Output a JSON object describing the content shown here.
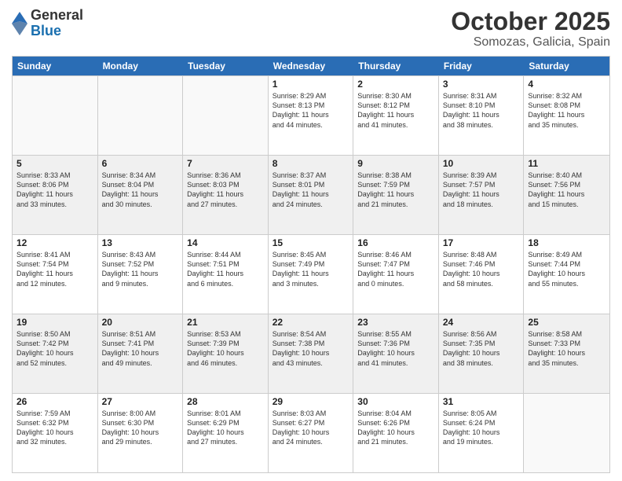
{
  "header": {
    "logo_general": "General",
    "logo_blue": "Blue",
    "title": "October 2025",
    "subtitle": "Somozas, Galicia, Spain"
  },
  "weekdays": [
    "Sunday",
    "Monday",
    "Tuesday",
    "Wednesday",
    "Thursday",
    "Friday",
    "Saturday"
  ],
  "rows": [
    [
      {
        "day": "",
        "empty": true
      },
      {
        "day": "",
        "empty": true
      },
      {
        "day": "",
        "empty": true
      },
      {
        "day": "1",
        "lines": [
          "Sunrise: 8:29 AM",
          "Sunset: 8:13 PM",
          "Daylight: 11 hours",
          "and 44 minutes."
        ]
      },
      {
        "day": "2",
        "lines": [
          "Sunrise: 8:30 AM",
          "Sunset: 8:12 PM",
          "Daylight: 11 hours",
          "and 41 minutes."
        ]
      },
      {
        "day": "3",
        "lines": [
          "Sunrise: 8:31 AM",
          "Sunset: 8:10 PM",
          "Daylight: 11 hours",
          "and 38 minutes."
        ]
      },
      {
        "day": "4",
        "lines": [
          "Sunrise: 8:32 AM",
          "Sunset: 8:08 PM",
          "Daylight: 11 hours",
          "and 35 minutes."
        ]
      }
    ],
    [
      {
        "day": "5",
        "lines": [
          "Sunrise: 8:33 AM",
          "Sunset: 8:06 PM",
          "Daylight: 11 hours",
          "and 33 minutes."
        ]
      },
      {
        "day": "6",
        "lines": [
          "Sunrise: 8:34 AM",
          "Sunset: 8:04 PM",
          "Daylight: 11 hours",
          "and 30 minutes."
        ]
      },
      {
        "day": "7",
        "lines": [
          "Sunrise: 8:36 AM",
          "Sunset: 8:03 PM",
          "Daylight: 11 hours",
          "and 27 minutes."
        ]
      },
      {
        "day": "8",
        "lines": [
          "Sunrise: 8:37 AM",
          "Sunset: 8:01 PM",
          "Daylight: 11 hours",
          "and 24 minutes."
        ]
      },
      {
        "day": "9",
        "lines": [
          "Sunrise: 8:38 AM",
          "Sunset: 7:59 PM",
          "Daylight: 11 hours",
          "and 21 minutes."
        ]
      },
      {
        "day": "10",
        "lines": [
          "Sunrise: 8:39 AM",
          "Sunset: 7:57 PM",
          "Daylight: 11 hours",
          "and 18 minutes."
        ]
      },
      {
        "day": "11",
        "lines": [
          "Sunrise: 8:40 AM",
          "Sunset: 7:56 PM",
          "Daylight: 11 hours",
          "and 15 minutes."
        ]
      }
    ],
    [
      {
        "day": "12",
        "lines": [
          "Sunrise: 8:41 AM",
          "Sunset: 7:54 PM",
          "Daylight: 11 hours",
          "and 12 minutes."
        ]
      },
      {
        "day": "13",
        "lines": [
          "Sunrise: 8:43 AM",
          "Sunset: 7:52 PM",
          "Daylight: 11 hours",
          "and 9 minutes."
        ]
      },
      {
        "day": "14",
        "lines": [
          "Sunrise: 8:44 AM",
          "Sunset: 7:51 PM",
          "Daylight: 11 hours",
          "and 6 minutes."
        ]
      },
      {
        "day": "15",
        "lines": [
          "Sunrise: 8:45 AM",
          "Sunset: 7:49 PM",
          "Daylight: 11 hours",
          "and 3 minutes."
        ]
      },
      {
        "day": "16",
        "lines": [
          "Sunrise: 8:46 AM",
          "Sunset: 7:47 PM",
          "Daylight: 11 hours",
          "and 0 minutes."
        ]
      },
      {
        "day": "17",
        "lines": [
          "Sunrise: 8:48 AM",
          "Sunset: 7:46 PM",
          "Daylight: 10 hours",
          "and 58 minutes."
        ]
      },
      {
        "day": "18",
        "lines": [
          "Sunrise: 8:49 AM",
          "Sunset: 7:44 PM",
          "Daylight: 10 hours",
          "and 55 minutes."
        ]
      }
    ],
    [
      {
        "day": "19",
        "lines": [
          "Sunrise: 8:50 AM",
          "Sunset: 7:42 PM",
          "Daylight: 10 hours",
          "and 52 minutes."
        ]
      },
      {
        "day": "20",
        "lines": [
          "Sunrise: 8:51 AM",
          "Sunset: 7:41 PM",
          "Daylight: 10 hours",
          "and 49 minutes."
        ]
      },
      {
        "day": "21",
        "lines": [
          "Sunrise: 8:53 AM",
          "Sunset: 7:39 PM",
          "Daylight: 10 hours",
          "and 46 minutes."
        ]
      },
      {
        "day": "22",
        "lines": [
          "Sunrise: 8:54 AM",
          "Sunset: 7:38 PM",
          "Daylight: 10 hours",
          "and 43 minutes."
        ]
      },
      {
        "day": "23",
        "lines": [
          "Sunrise: 8:55 AM",
          "Sunset: 7:36 PM",
          "Daylight: 10 hours",
          "and 41 minutes."
        ]
      },
      {
        "day": "24",
        "lines": [
          "Sunrise: 8:56 AM",
          "Sunset: 7:35 PM",
          "Daylight: 10 hours",
          "and 38 minutes."
        ]
      },
      {
        "day": "25",
        "lines": [
          "Sunrise: 8:58 AM",
          "Sunset: 7:33 PM",
          "Daylight: 10 hours",
          "and 35 minutes."
        ]
      }
    ],
    [
      {
        "day": "26",
        "lines": [
          "Sunrise: 7:59 AM",
          "Sunset: 6:32 PM",
          "Daylight: 10 hours",
          "and 32 minutes."
        ]
      },
      {
        "day": "27",
        "lines": [
          "Sunrise: 8:00 AM",
          "Sunset: 6:30 PM",
          "Daylight: 10 hours",
          "and 29 minutes."
        ]
      },
      {
        "day": "28",
        "lines": [
          "Sunrise: 8:01 AM",
          "Sunset: 6:29 PM",
          "Daylight: 10 hours",
          "and 27 minutes."
        ]
      },
      {
        "day": "29",
        "lines": [
          "Sunrise: 8:03 AM",
          "Sunset: 6:27 PM",
          "Daylight: 10 hours",
          "and 24 minutes."
        ]
      },
      {
        "day": "30",
        "lines": [
          "Sunrise: 8:04 AM",
          "Sunset: 6:26 PM",
          "Daylight: 10 hours",
          "and 21 minutes."
        ]
      },
      {
        "day": "31",
        "lines": [
          "Sunrise: 8:05 AM",
          "Sunset: 6:24 PM",
          "Daylight: 10 hours",
          "and 19 minutes."
        ]
      },
      {
        "day": "",
        "empty": true
      }
    ]
  ]
}
